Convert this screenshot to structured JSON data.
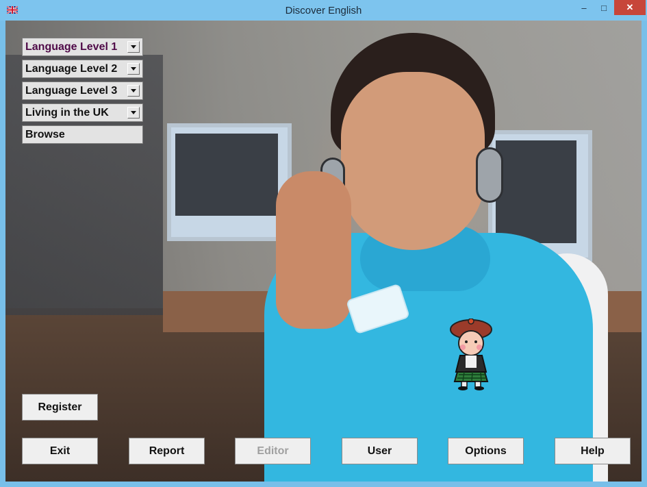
{
  "window": {
    "title": "Discover English",
    "controls": {
      "minimize": "–",
      "maximize": "□",
      "close": "✕"
    }
  },
  "menu": [
    {
      "label": "Language Level 1",
      "dropdown": true,
      "active": true
    },
    {
      "label": "Language Level 2",
      "dropdown": true
    },
    {
      "label": "Language Level 3",
      "dropdown": true
    },
    {
      "label": "Living in the UK",
      "dropdown": true
    },
    {
      "label": "Browse",
      "dropdown": false
    }
  ],
  "buttons": {
    "register": "Register",
    "exit": "Exit",
    "report": "Report",
    "editor": "Editor",
    "user": "User",
    "options": "Options",
    "help": "Help"
  },
  "icons": {
    "app": "uk-flag-icon",
    "mascot": "scottish-boy-mascot-icon"
  },
  "colors": {
    "titlebar": "#7dc4ee",
    "close_button": "#c7463a",
    "active_menu_text": "#4f0a48",
    "disabled_text": "#a0a0a0"
  }
}
